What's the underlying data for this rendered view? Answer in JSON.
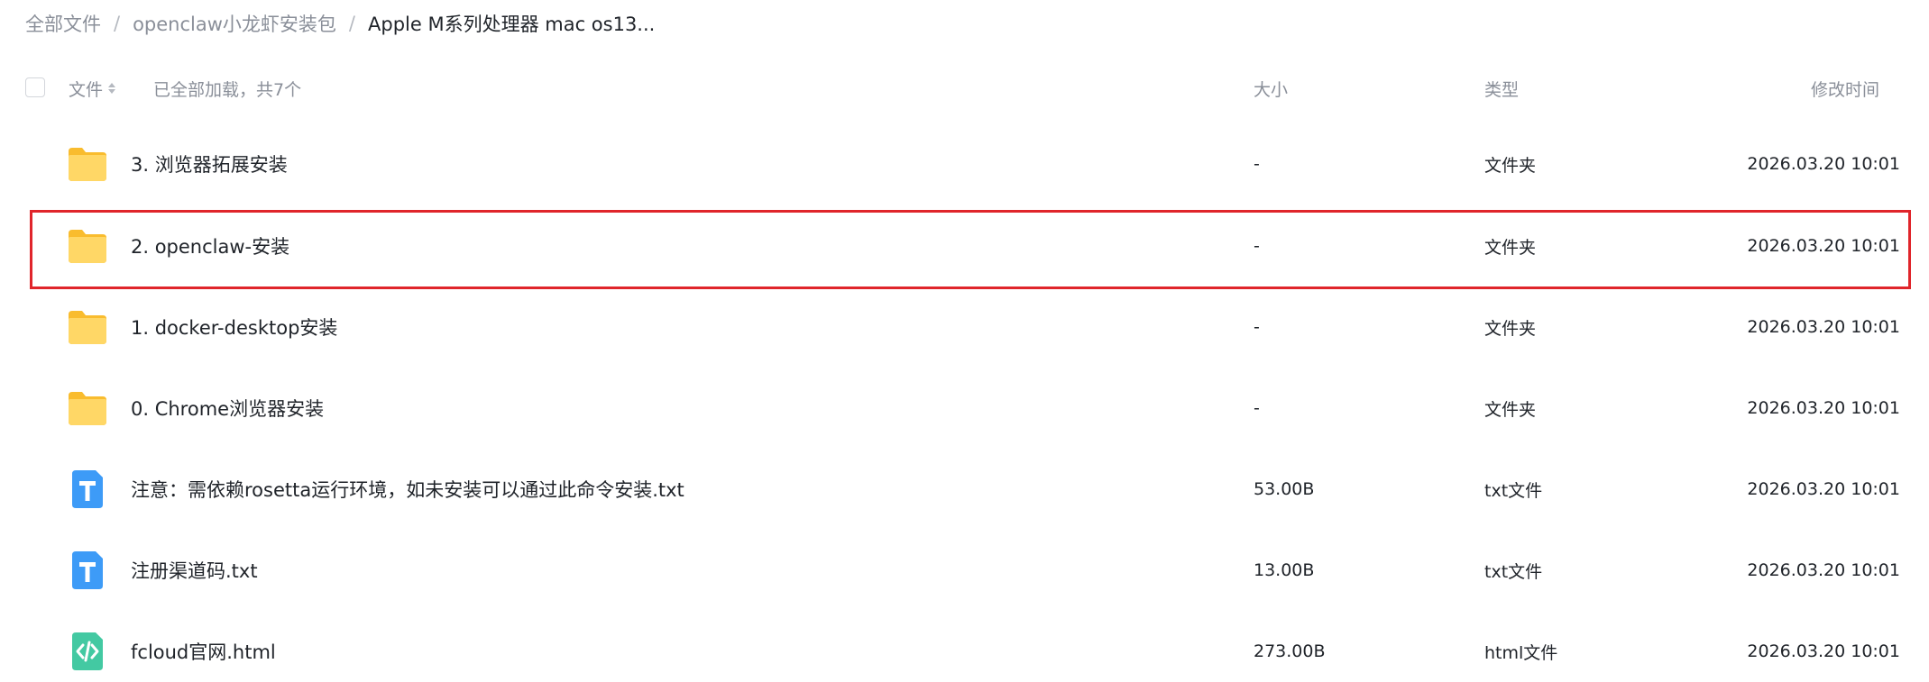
{
  "breadcrumb": {
    "items": [
      "全部文件",
      "openclaw小龙虾安装包",
      "Apple M系列处理器 mac os13..."
    ],
    "separator": "/"
  },
  "header": {
    "file_label": "文件",
    "load_status": "已全部加载，共7个",
    "size_label": "大小",
    "type_label": "类型",
    "modified_label": "修改时间"
  },
  "files": [
    {
      "name": "3. 浏览器拓展安装",
      "size": "-",
      "type": "文件夹",
      "modified": "2026.03.20 10:01",
      "icon": "folder-icon"
    },
    {
      "name": "2. openclaw-安装",
      "size": "-",
      "type": "文件夹",
      "modified": "2026.03.20 10:01",
      "icon": "folder-icon"
    },
    {
      "name": "1. docker-desktop安装",
      "size": "-",
      "type": "文件夹",
      "modified": "2026.03.20 10:01",
      "icon": "folder-icon"
    },
    {
      "name": "0. Chrome浏览器安装",
      "size": "-",
      "type": "文件夹",
      "modified": "2026.03.20 10:01",
      "icon": "folder-icon"
    },
    {
      "name": "注意：需依赖rosetta运行环境，如未安装可以通过此命令安装.txt",
      "size": "53.00B",
      "type": "txt文件",
      "modified": "2026.03.20 10:01",
      "icon": "txt-file-icon"
    },
    {
      "name": "注册渠道码.txt",
      "size": "13.00B",
      "type": "txt文件",
      "modified": "2026.03.20 10:01",
      "icon": "txt-file-icon"
    },
    {
      "name": "fcloud官网.html",
      "size": "273.00B",
      "type": "html文件",
      "modified": "2026.03.20 10:01",
      "icon": "html-file-icon"
    }
  ],
  "colors": {
    "folder": "#fcc945",
    "txt_icon": "#3d9bf7",
    "html_icon": "#43c9a2",
    "highlight": "#e0252b",
    "muted_text": "#8a8f99"
  }
}
